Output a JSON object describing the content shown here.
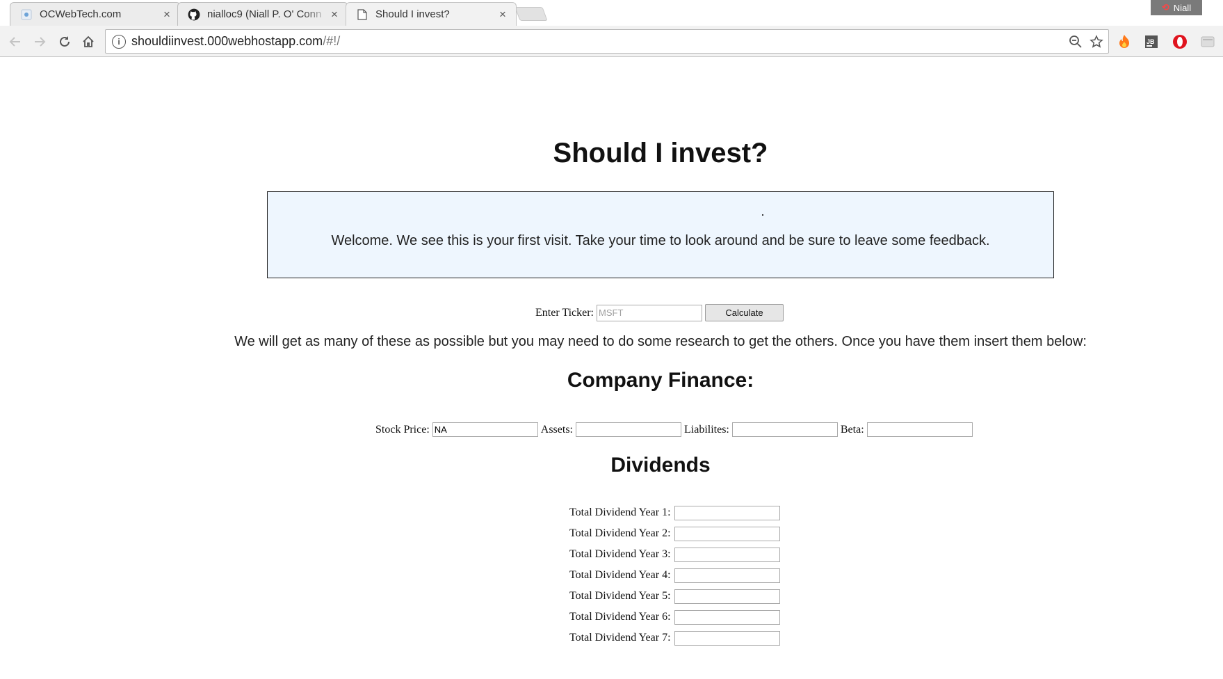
{
  "browser": {
    "tabs": [
      {
        "title": "OCWebTech.com",
        "icon": "ocwebtech-icon",
        "active": false
      },
      {
        "title": "nialloc9 (Niall P. O' Conn",
        "icon": "github-icon",
        "active": false
      },
      {
        "title": "Should I invest?",
        "icon": "document-icon",
        "active": true
      }
    ],
    "profile_name": "Niall",
    "url_host": "shouldiinvest.000webhostapp.com",
    "url_path": "/#!/"
  },
  "page": {
    "title": "Should I invest?",
    "welcome_message": "Welcome. We see this is your first visit. Take your time to look around and be sure to leave some feedback.",
    "ticker": {
      "label": "Enter Ticker:",
      "placeholder": "MSFT",
      "value": "",
      "button_label": "Calculate"
    },
    "instructions": "We will get as many of these as possible but you may need to do some research to get the others. Once you have them insert them below:",
    "company_finance": {
      "heading": "Company Finance:",
      "fields": [
        {
          "label": "Stock Price:",
          "value": "NA"
        },
        {
          "label": "Assets:",
          "value": ""
        },
        {
          "label": "Liabilites:",
          "value": ""
        },
        {
          "label": "Beta:",
          "value": ""
        }
      ]
    },
    "dividends": {
      "heading": "Dividends",
      "fields": [
        {
          "label": "Total Dividend Year 1:",
          "value": ""
        },
        {
          "label": "Total Dividend Year 2:",
          "value": ""
        },
        {
          "label": "Total Dividend Year 3:",
          "value": ""
        },
        {
          "label": "Total Dividend Year 4:",
          "value": ""
        },
        {
          "label": "Total Dividend Year 5:",
          "value": ""
        },
        {
          "label": "Total Dividend Year 6:",
          "value": ""
        },
        {
          "label": "Total Dividend Year 7:",
          "value": ""
        }
      ]
    }
  },
  "colors": {
    "welcome_bg": "#eef6fe",
    "chrome_bg": "#f2f2f2"
  }
}
